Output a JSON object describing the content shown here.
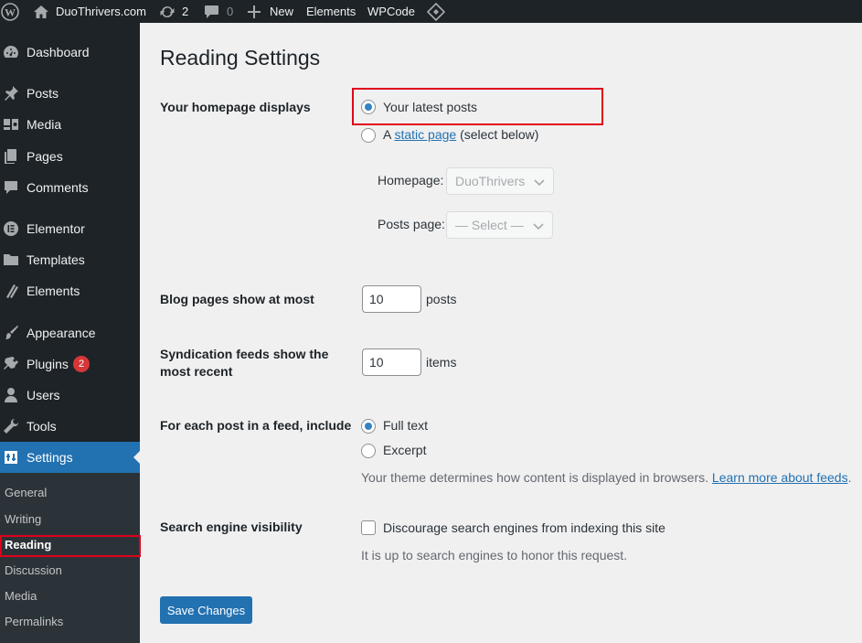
{
  "admin_bar": {
    "site_name": "DuoThrivers.com",
    "updates_count": "2",
    "comments_count": "0",
    "new_label": "New",
    "elements_label": "Elements",
    "wpcode_label": "WPCode"
  },
  "sidebar": {
    "items": [
      {
        "label": "Dashboard",
        "icon": "dashboard-icon"
      },
      {
        "label": "Posts",
        "icon": "pin-icon"
      },
      {
        "label": "Media",
        "icon": "media-icon"
      },
      {
        "label": "Pages",
        "icon": "pages-icon"
      },
      {
        "label": "Comments",
        "icon": "comment-icon"
      },
      {
        "label": "Elementor",
        "icon": "elementor-icon"
      },
      {
        "label": "Templates",
        "icon": "folder-icon"
      },
      {
        "label": "Elements",
        "icon": "elements-icon"
      },
      {
        "label": "Appearance",
        "icon": "brush-icon"
      },
      {
        "label": "Plugins",
        "icon": "plugin-icon",
        "badge": "2"
      },
      {
        "label": "Users",
        "icon": "user-icon"
      },
      {
        "label": "Tools",
        "icon": "wrench-icon"
      },
      {
        "label": "Settings",
        "icon": "settings-icon"
      }
    ],
    "submenu": [
      "General",
      "Writing",
      "Reading",
      "Discussion",
      "Media",
      "Permalinks"
    ],
    "current_submenu": "Reading"
  },
  "page": {
    "title": "Reading Settings",
    "homepage_displays": {
      "label": "Your homepage displays",
      "option_latest": "Your latest posts",
      "option_static_prefix": "A",
      "option_static_link": "static page",
      "option_static_suffix": "(select below)",
      "selected": "latest",
      "homepage_label": "Homepage:",
      "homepage_value": "DuoThrivers",
      "posts_page_label": "Posts page:",
      "posts_page_value": "— Select —"
    },
    "blog_pages": {
      "label": "Blog pages show at most",
      "value": "10",
      "unit": "posts"
    },
    "syndication": {
      "label": "Syndication feeds show the most recent",
      "value": "10",
      "unit": "items"
    },
    "feed_include": {
      "label": "For each post in a feed, include",
      "option_full": "Full text",
      "option_excerpt": "Excerpt",
      "selected": "full",
      "description": "Your theme determines how content is displayed in browsers.",
      "description_link": "Learn more about feeds",
      "description_end": "."
    },
    "search_visibility": {
      "label": "Search engine visibility",
      "checkbox_label": "Discourage search engines from indexing this site",
      "checked": false,
      "description": "It is up to search engines to honor this request."
    },
    "save_button": "Save Changes"
  },
  "colors": {
    "admin_bar": "#1d2327",
    "sidebar": "#1d2327",
    "accent": "#2271b1",
    "highlight_box": "#e0001b"
  }
}
